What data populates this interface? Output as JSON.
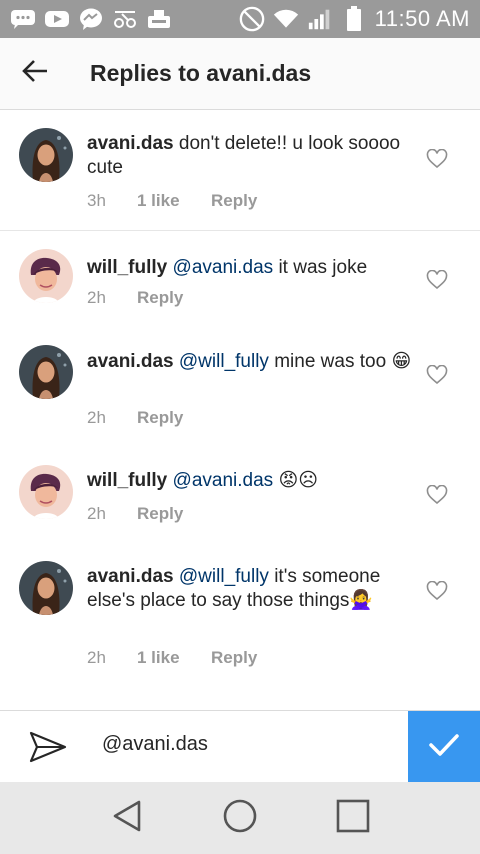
{
  "status_bar": {
    "time": "11:50 AM",
    "icons": [
      "chat-icon",
      "youtube-icon",
      "messenger-icon",
      "link-icon",
      "tray-icon",
      "do-not-disturb-icon",
      "wifi-icon",
      "signal-icon",
      "battery-icon"
    ]
  },
  "header": {
    "back_icon": "arrow-left-icon",
    "title": "Replies to avani.das"
  },
  "comments": [
    {
      "username": "avani.das",
      "mention": "",
      "text": "don't delete!! u look soooo cute",
      "emoji": "",
      "time": "3h",
      "likes": "1 like",
      "reply": "Reply"
    },
    {
      "username": "will_fully",
      "mention": "@avani.das",
      "text": "it was joke",
      "emoji": "",
      "time": "2h",
      "likes": "",
      "reply": "Reply"
    },
    {
      "username": "avani.das",
      "mention": "@will_fully",
      "text": "mine was too",
      "emoji": "😁",
      "time": "2h",
      "likes": "",
      "reply": "Reply"
    },
    {
      "username": "will_fully",
      "mention": "@avani.das",
      "text": "",
      "emoji": "😡☹",
      "time": "2h",
      "likes": "",
      "reply": "Reply"
    },
    {
      "username": "avani.das",
      "mention": "@will_fully",
      "text": "it's someone else's place to say those things🙅‍♀️",
      "emoji": "",
      "time": "2h",
      "likes": "1 like",
      "reply": "Reply"
    }
  ],
  "input": {
    "value": "@avani.das",
    "send_icon": "paper-plane-icon",
    "post_icon": "checkmark-icon"
  },
  "nav": {
    "icons": [
      "back-triangle-icon",
      "home-circle-icon",
      "recents-square-icon"
    ]
  },
  "colors": {
    "accent": "#3897f0",
    "mention": "#003569",
    "meta": "#999999",
    "status_bar": "#9a9a9a"
  }
}
